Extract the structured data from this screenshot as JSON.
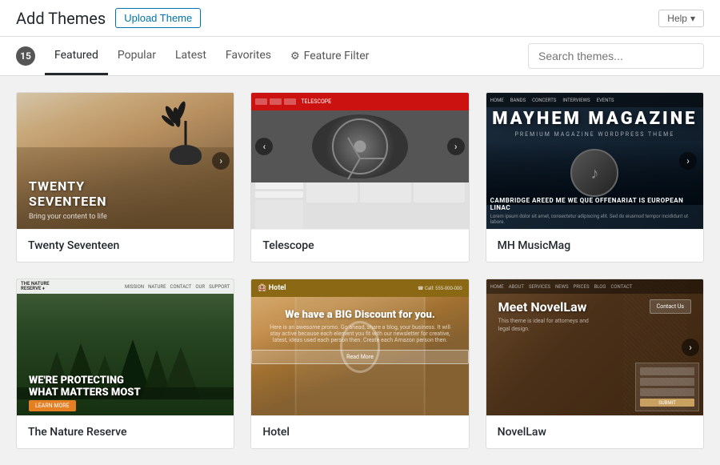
{
  "header": {
    "title": "Add Themes",
    "upload_button": "Upload Theme",
    "help_button": "Help"
  },
  "nav": {
    "count": "15",
    "tabs": [
      {
        "id": "featured",
        "label": "Featured",
        "active": true
      },
      {
        "id": "popular",
        "label": "Popular",
        "active": false
      },
      {
        "id": "latest",
        "label": "Latest",
        "active": false
      },
      {
        "id": "favorites",
        "label": "Favorites",
        "active": false
      }
    ],
    "feature_filter": "Feature Filter",
    "search_placeholder": "Search themes..."
  },
  "themes": [
    {
      "id": "twenty-seventeen",
      "name": "Twenty Seventeen",
      "label": "TWENTY SEVENTEEN",
      "subtitle": "Bring your content to life",
      "row": 1
    },
    {
      "id": "telescope",
      "name": "Telescope",
      "row": 1
    },
    {
      "id": "mh-musicmag",
      "name": "MH MusicMag",
      "title": "MAYHEM MAGAZINE",
      "subtitle": "PREMIUM MAGAZINE WORDPRESS THEME",
      "row": 1
    },
    {
      "id": "nature-reserve",
      "name": "The Nature Reserve",
      "hero_text": "WE'RE PROTECTING\nWHAT MATTERS MOST",
      "row": 2
    },
    {
      "id": "hotel",
      "name": "Hotel",
      "cta": "We have a BIG Discount for you.",
      "row": 2
    },
    {
      "id": "novellaw",
      "name": "NovelLaw",
      "title": "Meet NovelLaw",
      "subtitle": "This theme is ideal for attorneys and legal design.",
      "row": 2
    }
  ]
}
